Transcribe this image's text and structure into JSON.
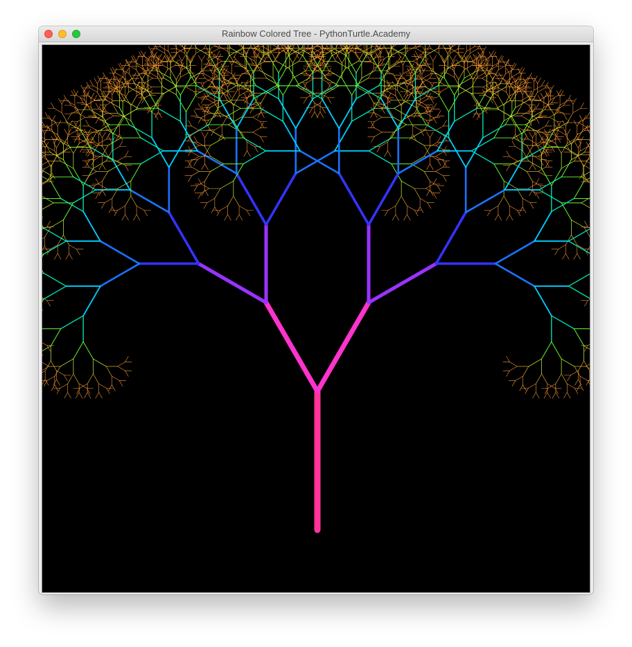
{
  "window": {
    "title": "Rainbow Colored Tree - PythonTurtle.Academy",
    "controls": [
      "close",
      "minimize",
      "zoom"
    ]
  },
  "canvas": {
    "background": "#000000"
  },
  "tree": {
    "palette": [
      "#ff3399",
      "#ff33cc",
      "#9933ff",
      "#3333ff",
      "#1a73ff",
      "#00ccff",
      "#00e6b8",
      "#66ff33",
      "#ccff33",
      "#ffcc33",
      "#ff9933"
    ],
    "trunk_color": "#ff3399"
  }
}
